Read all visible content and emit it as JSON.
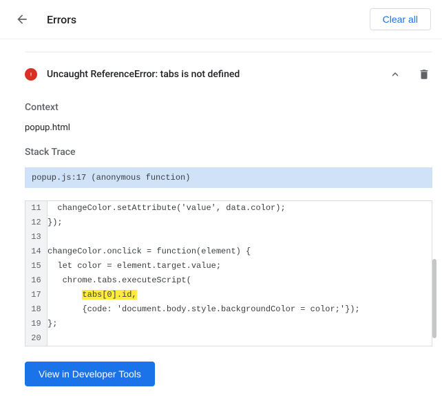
{
  "header": {
    "title": "Errors",
    "clearAll": "Clear all"
  },
  "error": {
    "message": "Uncaught ReferenceError: tabs is not defined",
    "context_heading": "Context",
    "context_value": "popup.html",
    "trace_heading": "Stack Trace",
    "trace_label": "popup.js:17 (anonymous function)"
  },
  "code": {
    "lines": [
      {
        "num": "11",
        "indent": "  ",
        "text": "changeColor.setAttribute('value', data.color);",
        "highlight": false
      },
      {
        "num": "12",
        "indent": "",
        "text": "});",
        "highlight": false
      },
      {
        "num": "13",
        "indent": "",
        "text": "",
        "highlight": false
      },
      {
        "num": "14",
        "indent": "",
        "text": "changeColor.onclick = function(element) {",
        "highlight": false
      },
      {
        "num": "15",
        "indent": "  ",
        "text": "let color = element.target.value;",
        "highlight": false
      },
      {
        "num": "16",
        "indent": "   ",
        "text": "chrome.tabs.executeScript(",
        "highlight": false
      },
      {
        "num": "17",
        "indent": "       ",
        "text": "tabs[0].id,",
        "highlight": true
      },
      {
        "num": "18",
        "indent": "       ",
        "text": "{code: 'document.body.style.backgroundColor = color;'});",
        "highlight": false
      },
      {
        "num": "19",
        "indent": "",
        "text": "};",
        "highlight": false
      },
      {
        "num": "20",
        "indent": "",
        "text": "",
        "highlight": false
      }
    ]
  },
  "buttons": {
    "devTools": "View in Developer Tools"
  }
}
